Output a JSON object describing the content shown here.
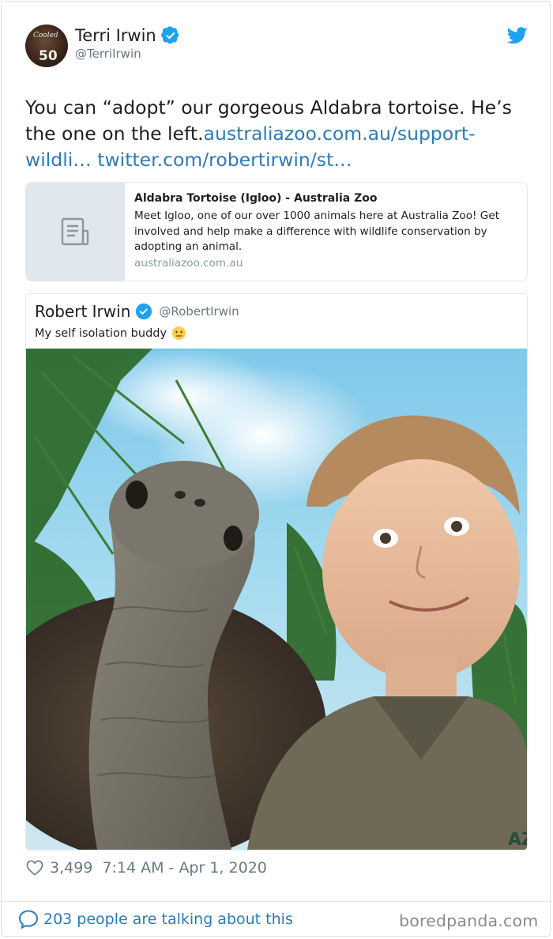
{
  "author": {
    "name": "Terri Irwin",
    "handle": "@TerriIrwin",
    "avatar_text": "50",
    "avatar_script": "Cooled"
  },
  "tweet": {
    "text_plain": "You can “adopt” our gorgeous Aldabra tortoise. He’s the one on the left.",
    "link1": "australiazoo.com.au/support-wildli…",
    "link2": "twitter.com/robertirwin/st…"
  },
  "link_card": {
    "title": "Aldabra Tortoise (Igloo) - Australia Zoo",
    "description": "Meet Igloo, one of our over 1000 animals here at Australia Zoo! Get involved and help make a difference with wildlife conservation by adopting an animal.",
    "domain": "australiazoo.com.au"
  },
  "quoted": {
    "name": "Robert Irwin",
    "handle": "@RobertIrwin",
    "text": "My self isolation buddy"
  },
  "footer": {
    "likes": "3,499",
    "timestamp": "7:14 AM - Apr 1, 2020",
    "talking": "203 people are talking about this"
  },
  "watermark": "boredpanda.com",
  "colors": {
    "link": "#2b7bb9",
    "verified": "#1da1f2",
    "muted": "#697882"
  },
  "icons": [
    "verified-badge-icon",
    "twitter-bird-icon",
    "document-icon",
    "neutral-face-emoji",
    "heart-icon",
    "speech-bubble-icon"
  ]
}
